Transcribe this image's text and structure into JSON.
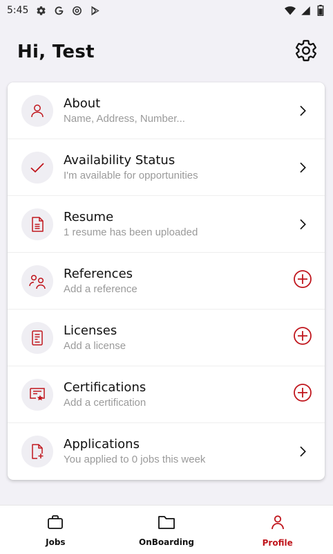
{
  "status_bar": {
    "time": "5:45",
    "left_icons": [
      "gear-icon",
      "google-g-icon",
      "at-sign-icon",
      "play-store-icon"
    ],
    "right_icons": [
      "wifi-icon",
      "signal-icon",
      "battery-icon"
    ]
  },
  "header": {
    "greeting": "Hi, Test",
    "settings_icon": "gear-icon"
  },
  "menu": {
    "items": [
      {
        "title": "About",
        "subtitle": "Name, Address, Number...",
        "icon": "person-icon",
        "action": "chevron-right-icon"
      },
      {
        "title": "Availability Status",
        "subtitle": "I'm available for opportunities",
        "icon": "checkmark-icon",
        "action": "chevron-right-icon"
      },
      {
        "title": "Resume",
        "subtitle": "1 resume has been uploaded",
        "icon": "document-icon",
        "action": "chevron-right-icon"
      },
      {
        "title": "References",
        "subtitle": "Add a reference",
        "icon": "people-icon",
        "action": "plus-circle-icon"
      },
      {
        "title": "Licenses",
        "subtitle": "Add a license",
        "icon": "license-icon",
        "action": "plus-circle-icon"
      },
      {
        "title": "Certifications",
        "subtitle": "Add a certification",
        "icon": "certificate-icon",
        "action": "plus-circle-icon"
      },
      {
        "title": "Applications",
        "subtitle": "You applied to 0 jobs this week",
        "icon": "file-add-icon",
        "action": "chevron-right-icon"
      }
    ]
  },
  "bottom_nav": {
    "items": [
      {
        "label": "Jobs",
        "icon": "briefcase-icon",
        "active": false
      },
      {
        "label": "OnBoarding",
        "icon": "folder-icon",
        "active": false
      },
      {
        "label": "Profile",
        "icon": "person-icon",
        "active": true
      }
    ]
  },
  "colors": {
    "accent": "#c0161d",
    "background": "#f2f1f6",
    "card": "#ffffff",
    "icon_circle": "#efeef3",
    "subtitle": "#9a9a9a"
  }
}
